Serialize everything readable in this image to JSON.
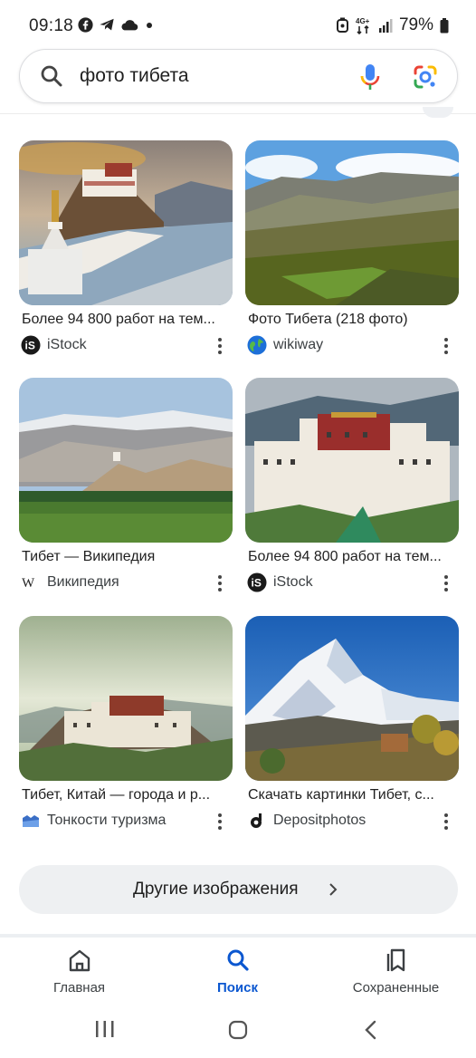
{
  "status_bar": {
    "time": "09:18",
    "battery": "79%",
    "icons_left": [
      "facebook-icon",
      "telegram-icon",
      "cloud-icon",
      "dot-icon"
    ],
    "icons_right": [
      "alarm-icon",
      "network-4g-icon",
      "signal-icon",
      "battery-icon"
    ]
  },
  "search": {
    "query": "фото тибета",
    "icons": [
      "search-icon",
      "mic-icon",
      "google-lens-icon"
    ]
  },
  "results": [
    {
      "title": "Более 94 800 работ на тем...",
      "source": "iStock",
      "logo": "istock-logo"
    },
    {
      "title": "Фото Тибета (218 фото)",
      "source": "wikiway",
      "logo": "globe-logo"
    },
    {
      "title": "Тибет — Википедия",
      "source": "Википедия",
      "logo": "wikipedia-logo"
    },
    {
      "title": "Более 94 800 работ на тем...",
      "source": "iStock",
      "logo": "istock-logo"
    },
    {
      "title": "Тибет, Китай — города и р...",
      "source": "Тонкости туризма",
      "logo": "tonkosti-logo"
    },
    {
      "title": "Скачать картинки Тибет, с...",
      "source": "Depositphotos",
      "logo": "depositphotos-logo"
    }
  ],
  "more_button": {
    "label": "Другие изображения"
  },
  "bottom_nav": [
    {
      "label": "Главная",
      "icon": "home-icon",
      "active": false
    },
    {
      "label": "Поиск",
      "icon": "search-icon",
      "active": true
    },
    {
      "label": "Сохраненные",
      "icon": "saved-icon",
      "active": false
    }
  ],
  "colors": {
    "accent": "#0b57d0",
    "chip_bg": "#eef0f2"
  }
}
